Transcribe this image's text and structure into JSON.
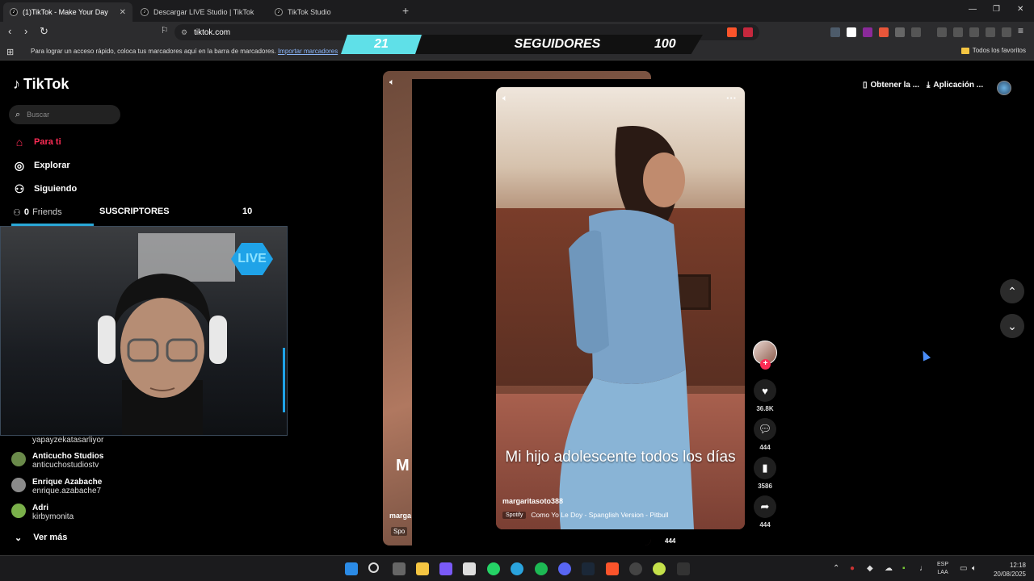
{
  "browser": {
    "tabs": [
      {
        "label": "(1)TikTok - Make Your Day",
        "active": true
      },
      {
        "label": "Descargar LIVE Studio | TikTok",
        "active": false
      },
      {
        "label": "TikTok Studio",
        "active": false
      }
    ],
    "url": "tiktok.com",
    "bookmarks_message": "Para lograr un acceso rápido, coloca tus marcadores aquí en la barra de marcadores.",
    "bookmarks_link": "Importar marcadores",
    "all_favorites": "Todos los favoritos"
  },
  "overlay": {
    "followers_count": "21",
    "followers_label": "SEGUIDORES",
    "followers_goal": "100",
    "subscribers_label": "SUSCRIPTORES",
    "subscribers_count": "10",
    "live_badge": "LIVE"
  },
  "sidebar": {
    "brand": "TikTok",
    "search_placeholder": "Buscar",
    "nav": [
      {
        "label": "Para ti",
        "icon": "home-icon",
        "active": true
      },
      {
        "label": "Explorar",
        "icon": "compass-icon",
        "active": false
      },
      {
        "label": "Siguiendo",
        "icon": "following-icon",
        "active": false
      }
    ],
    "friends_label": "Friends",
    "friends_count": "0",
    "following_accounts": [
      {
        "name": "",
        "handle": "yapayzekatasarliyor",
        "color": "#5a4a3a"
      },
      {
        "name": "Anticucho Studios",
        "handle": "anticuchostudiostv",
        "color": "#6a8a4a"
      },
      {
        "name": "Enrique Azabache",
        "handle": "enrique.azabache7",
        "color": "#8a8a8a"
      },
      {
        "name": "Adri",
        "handle": "kirbymonita",
        "color": "#7ab04a"
      }
    ],
    "see_more": "Ver más"
  },
  "video": {
    "caption": "Mi hijo adolescente todos los días",
    "username": "margaritasoto388",
    "music_source": "Spotify",
    "music": "Como Yo Le Doy - Spanglish Version - Pitbull",
    "likes": "36.8K",
    "comments": "444",
    "saves": "3586",
    "shares": "444",
    "extra_count": "444"
  },
  "background_video": {
    "caption_fragment": "M",
    "user_fragment": "marga",
    "spotify_fragment": "Spo"
  },
  "topbar": {
    "get_coins": "Obtener la ...",
    "download_app": "Aplicación ..."
  },
  "taskbar": {
    "language": "ESP",
    "layout": "LAA",
    "time": "12:18",
    "date": "20/08/2025"
  }
}
